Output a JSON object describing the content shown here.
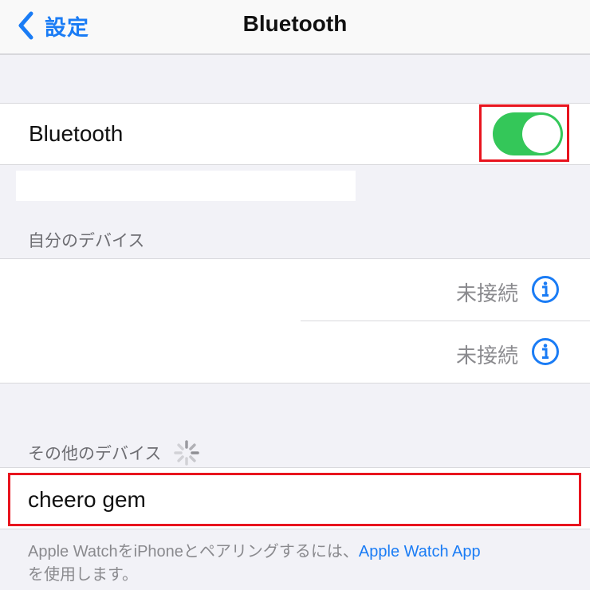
{
  "nav": {
    "back_label": "設定",
    "title": "Bluetooth"
  },
  "bluetooth": {
    "label": "Bluetooth",
    "enabled": true,
    "toggle_color": "#34c759"
  },
  "my_devices": {
    "header": "自分のデバイス",
    "items": [
      {
        "name": "",
        "status": "未接続"
      },
      {
        "name": "",
        "status": "未接続"
      }
    ]
  },
  "other_devices": {
    "header": "その他のデバイス",
    "items": [
      {
        "name": "cheero gem"
      }
    ]
  },
  "footer": {
    "text": "Apple WatchをiPhoneとペアリングするには、",
    "link": "Apple Watch App",
    "text_after": "を使用します。"
  },
  "colors": {
    "accent": "#1a7cf5",
    "highlight": "#e8141e"
  }
}
